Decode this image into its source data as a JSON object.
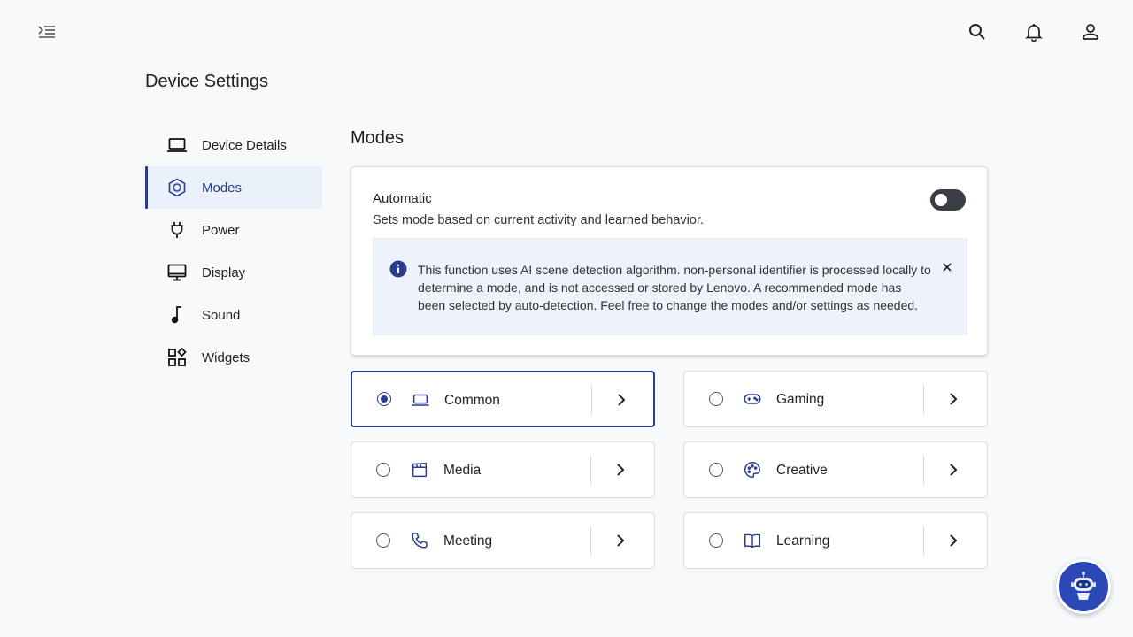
{
  "header": {
    "page_title": "Device Settings",
    "icons": [
      "menu-collapse-icon",
      "search-icon",
      "bell-icon",
      "user-icon"
    ]
  },
  "sidebar": {
    "items": [
      {
        "label": "Device Details",
        "icon": "laptop-icon",
        "active": false
      },
      {
        "label": "Modes",
        "icon": "hexagon-icon",
        "active": true
      },
      {
        "label": "Power",
        "icon": "plug-icon",
        "active": false
      },
      {
        "label": "Display",
        "icon": "monitor-icon",
        "active": false
      },
      {
        "label": "Sound",
        "icon": "music-note-icon",
        "active": false
      },
      {
        "label": "Widgets",
        "icon": "widgets-icon",
        "active": false
      }
    ]
  },
  "main": {
    "section_title": "Modes",
    "automatic": {
      "title": "Automatic",
      "description": "Sets mode based on current activity and learned behavior.",
      "toggle_on": false,
      "info": "This function uses AI scene detection algorithm. non-personal identifier is processed locally to determine a mode, and is not accessed or stored by Lenovo. A recommended mode has been selected by auto-detection. Feel free to change the modes and/or settings as needed."
    },
    "modes": [
      {
        "label": "Common",
        "icon": "laptop-icon",
        "selected": true
      },
      {
        "label": "Gaming",
        "icon": "gamepad-icon",
        "selected": false
      },
      {
        "label": "Media",
        "icon": "clapperboard-icon",
        "selected": false
      },
      {
        "label": "Creative",
        "icon": "palette-icon",
        "selected": false
      },
      {
        "label": "Meeting",
        "icon": "phone-icon",
        "selected": false
      },
      {
        "label": "Learning",
        "icon": "book-icon",
        "selected": false
      }
    ]
  },
  "colors": {
    "accent": "#2a3c8f",
    "active_bg": "#eaf0fa",
    "assistant_bg": "#2c47b6"
  }
}
